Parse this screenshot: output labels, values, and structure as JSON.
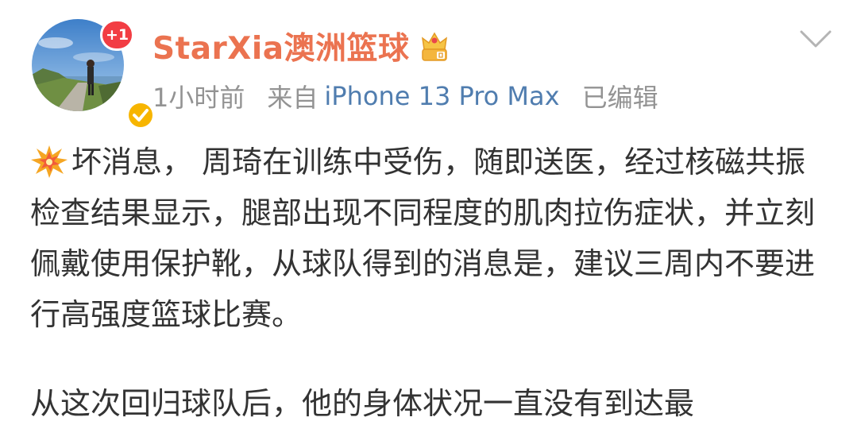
{
  "user": {
    "name": "StarXia澳洲篮球",
    "notification_badge": "+1",
    "avatar_icon": "avatar-photo",
    "verified_icon": "verified-badge-icon",
    "vip_icon": "crown-icon"
  },
  "meta": {
    "time": "1小时前",
    "from_label": "来自",
    "device": "iPhone 13 Pro Max",
    "edited": "已编辑"
  },
  "post": {
    "emoji_icon": "collision-icon",
    "paragraph1": "坏消息， 周琦在训练中受伤，随即送医，经过核磁共振检查结果显示，腿部出现不同程度的肌肉拉伤症状，并立刻佩戴使用保护靴，从球队得到的消息是，建议三周内不要进行高强度篮球比赛。",
    "paragraph2": "从这次回归球队后，他的身体状况一直没有到达最"
  },
  "colors": {
    "username": "#eb7350",
    "link": "#507daf",
    "meta": "#939393",
    "body_text": "#333333",
    "badge": "#f23d43",
    "verified": "#f7b500"
  }
}
